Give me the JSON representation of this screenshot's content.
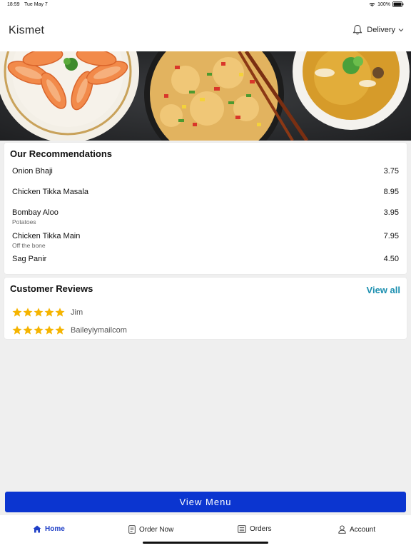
{
  "status_bar": {
    "time": "18:59",
    "date": "Tue May 7",
    "battery": "100%"
  },
  "header": {
    "title": "Kismet",
    "mode_label": "Delivery"
  },
  "hero": {
    "icon": "food-banner-image"
  },
  "recommendations": {
    "title": "Our Recommendations",
    "items": [
      {
        "name": "Onion Bhaji",
        "description": "",
        "price": "3.75"
      },
      {
        "name": "Chicken Tikka Masala",
        "description": "",
        "price": "8.95"
      },
      {
        "name": "Bombay Aloo",
        "description": "Potatoes",
        "price": "3.95"
      },
      {
        "name": "Chicken Tikka Main",
        "description": "Off the bone",
        "price": "7.95"
      },
      {
        "name": "Sag Panir",
        "description": "",
        "price": "4.50"
      }
    ]
  },
  "reviews": {
    "title": "Customer Reviews",
    "view_all_label": "View all",
    "items": [
      {
        "name": "Jim",
        "rating": 5
      },
      {
        "name": "Baileyiymailcom",
        "rating": 5
      }
    ]
  },
  "view_menu_label": "View Menu",
  "tabs": [
    {
      "label": "Home",
      "icon": "home-icon",
      "active": true
    },
    {
      "label": "Order Now",
      "icon": "order-icon",
      "active": false
    },
    {
      "label": "Orders",
      "icon": "orders-icon",
      "active": false
    },
    {
      "label": "Account",
      "icon": "account-icon",
      "active": false
    }
  ],
  "colors": {
    "accent": "#0b35d0",
    "link": "#1b8fb0",
    "star": "#f5b400",
    "active_tab": "#1f3fc7",
    "background": "#efefef"
  }
}
